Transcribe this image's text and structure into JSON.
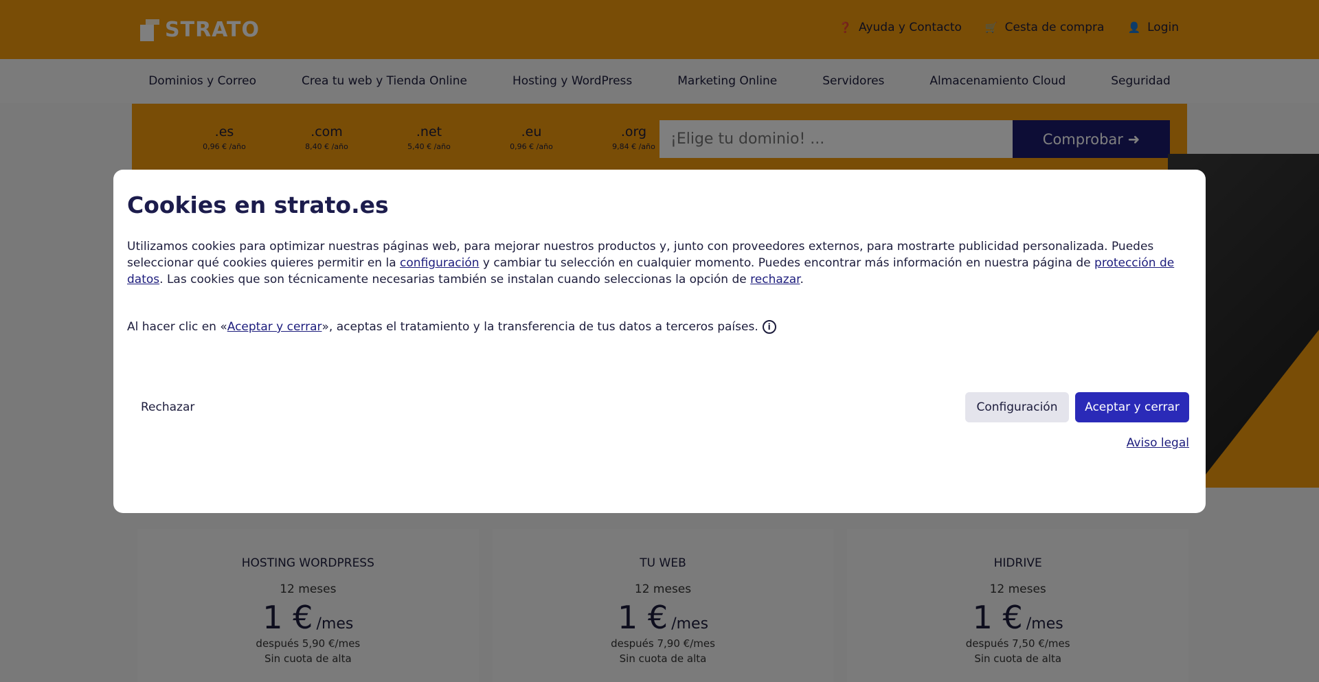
{
  "header": {
    "logo_text": "STRATO",
    "links": [
      {
        "icon": "help-icon",
        "label": "Ayuda y Contacto"
      },
      {
        "icon": "cart-icon",
        "label": "Cesta de compra"
      },
      {
        "icon": "user-icon",
        "label": "Login"
      }
    ]
  },
  "nav": {
    "items": [
      "Dominios y Correo",
      "Crea tu web y Tienda Online",
      "Hosting y WordPress",
      "Marketing Online",
      "Servidores",
      "Almacenamiento Cloud",
      "Seguridad"
    ]
  },
  "domain": {
    "tlds": [
      {
        "name": ".es",
        "price": "0,96 € /año"
      },
      {
        "name": ".com",
        "price": "8,40 € /año"
      },
      {
        "name": ".net",
        "price": "5,40 € /año"
      },
      {
        "name": ".eu",
        "price": "0,96 € /año"
      },
      {
        "name": ".org",
        "price": "9,84 € /año"
      }
    ],
    "placeholder": "¡Elige tu dominio! ...",
    "button_label": "Comprobar ➜"
  },
  "cards": [
    {
      "title": "HOSTING WORDPRESS",
      "term": "12 meses",
      "price": "1 €",
      "per": "/mes",
      "after": "después 5,90 €/mes",
      "fee": "Sin cuota de alta"
    },
    {
      "title": "TU WEB",
      "term": "12 meses",
      "price": "1 €",
      "per": "/mes",
      "after": "después 7,90 €/mes",
      "fee": "Sin cuota de alta"
    },
    {
      "title": "HIDRIVE",
      "term": "12 meses",
      "price": "1 €",
      "per": "/mes",
      "after": "después 7,50 €/mes",
      "fee": "Sin cuota de alta"
    }
  ],
  "cookie_modal": {
    "title": "Cookies en strato.es",
    "text_part1": "Utilizamos cookies para optimizar nuestras páginas web, para mejorar nuestros productos y, junto con proveedores externos, para mostrarte publicidad personalizada. Puedes seleccionar qué cookies quieres permitir en la ",
    "link_config": "configuración",
    "text_part2": " y cambiar tu selección en cualquier momento. Puedes encontrar más información en nuestra página de ",
    "link_privacy": "protección de datos",
    "text_part3": ". Las cookies que son técnicamente necesarias también se instalan cuando seleccionas la opción de ",
    "link_reject": "rechazar",
    "text_part4": ".",
    "consent_prefix": "Al hacer clic en «",
    "consent_link": "Aceptar y cerrar",
    "consent_suffix": "», aceptas el tratamiento y la transferencia de tus datos a terceros países.",
    "reject_label": "Rechazar",
    "config_label": "Configuración",
    "accept_label": "Aceptar y cerrar",
    "legal_label": "Aviso legal"
  }
}
